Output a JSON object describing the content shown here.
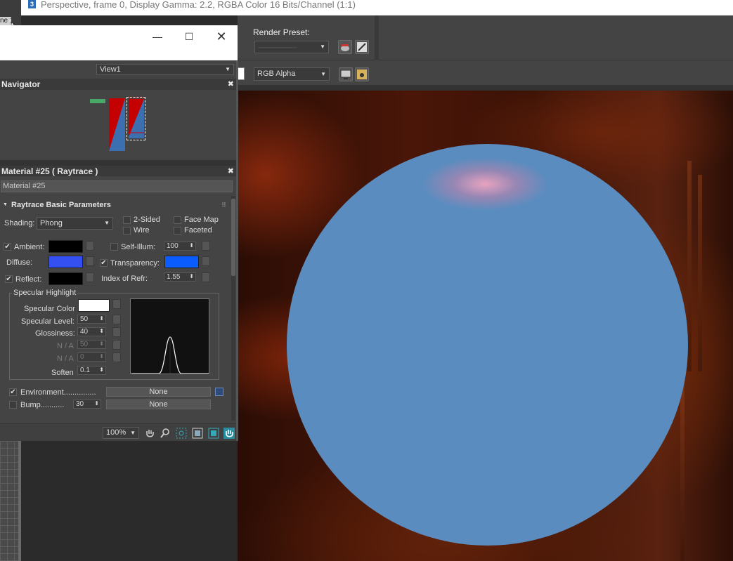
{
  "render_window": {
    "title": "Perspective, frame 0, Display Gamma: 2.2, RGBA Color 16 Bits/Channel (1:1)",
    "app_badge": "3",
    "render_preset_label": "Render Preset:",
    "render_preset_value": "---------------------",
    "channel_value": "RGB Alpha",
    "left_tab_label": "ne 1"
  },
  "editor": {
    "view_dropdown": "View1",
    "navigator_title": "Navigator",
    "material_title": "Material #25  ( Raytrace )",
    "material_name": "Material #25",
    "rollout_title": "Raytrace Basic Parameters",
    "shading_label": "Shading:",
    "shading_value": "Phong",
    "options": [
      "2-Sided",
      "Wire",
      "Face Map",
      "Faceted"
    ],
    "ambient_label": "Ambient:",
    "diffuse_label": "Diffuse:",
    "reflect_label": "Reflect:",
    "self_illum_label": "Self-Illum:",
    "self_illum_value": "100",
    "transparency_label": "Transparency:",
    "ior_label": "Index of Refr:",
    "ior_value": "1.55",
    "specular_group": "Specular Highlight",
    "specular_color_label": "Specular Color",
    "specular_level_label": "Specular Level:",
    "specular_level_value": "50",
    "glossiness_label": "Glossiness:",
    "glossiness_value": "40",
    "na_label_1": "N / A",
    "na_value_1": "50",
    "na_label_2": "N / A",
    "na_value_2": "0",
    "soften_label": "Soften",
    "soften_value": "0.1",
    "environment_label": "Environment...............",
    "environment_map": "None",
    "bump_label": "Bump...........",
    "bump_value": "30",
    "bump_map": "None",
    "zoom_value": "100%"
  },
  "colors": {
    "ambient": "#000000",
    "diffuse": "#3450f0",
    "reflect": "#000000",
    "transparency": "#0a5cff",
    "specular": "#ffffff",
    "sphere": "#5a8cbf"
  }
}
